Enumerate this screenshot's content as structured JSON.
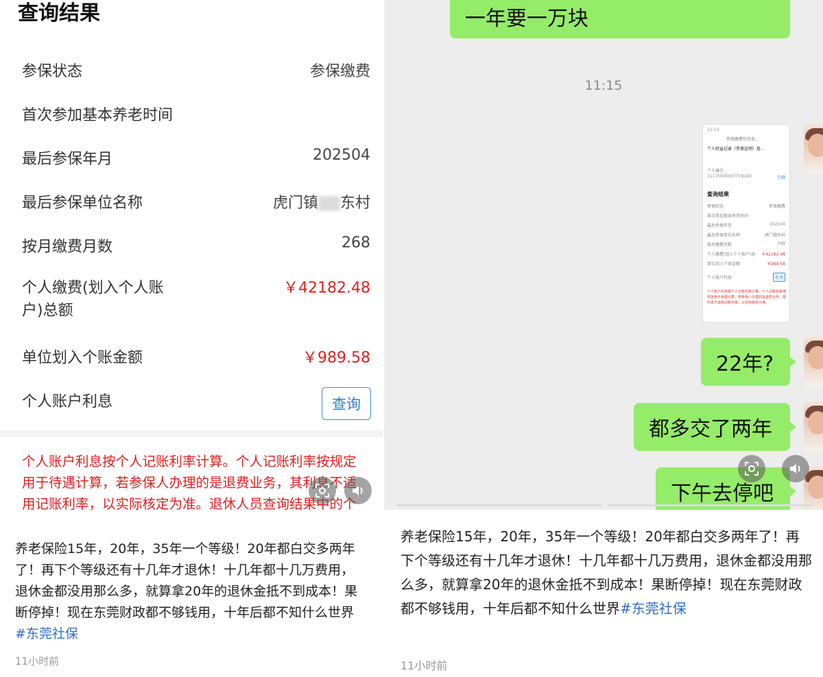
{
  "left": {
    "title": "查询结果",
    "rows": [
      {
        "label": "参保状态",
        "value": "参保缴费"
      },
      {
        "label": "首次参加基本养老时间",
        "value": ""
      },
      {
        "label": "最后参保年月",
        "value": "202504"
      },
      {
        "label": "最后参保单位名称",
        "value_prefix": "虎门镇",
        "value_suffix": "东村"
      },
      {
        "label": "按月缴费月数",
        "value": "268"
      },
      {
        "label_line1": "个人缴费(划入个人账",
        "label_line2": "户)总额",
        "value": "￥42182.48"
      },
      {
        "label": "单位划入个账金额",
        "value": "￥989.58"
      },
      {
        "label": "个人账户利息",
        "button": "查询"
      }
    ],
    "notice": "个人账户利息按个人记账利率计算。个人记账利率按规定用于待遇计算，若参保人办理的是退费业务，其利息不适用记账利率，以实际核定为准。退休人员查询结果中的个人账户利息是本人退休时的个人账户利",
    "caption": "养老保险15年，20年，35年一个等级！20年都白交多两年了！再下个等级还有十几年才退休！十几年都十几万费用，退休金都没用那么多，就算拿20年的退休金抵不到成本！果断停掉！现在东莞财政都不够钱用，十年后都不知什么世界",
    "caption_tag": "#东莞社保",
    "time": "11小时前"
  },
  "right": {
    "messages": [
      {
        "text": "一年要一万块"
      },
      {
        "text": "22年?"
      },
      {
        "text": "都多交了两年"
      },
      {
        "text": "下午去停吧"
      }
    ],
    "timestamp": "11:15",
    "thumbnail": {
      "status_time": "11:13",
      "header": "参保缴费状态查...",
      "record_title": "个人权益记录（参保证明）查...",
      "account_label": "个人编号",
      "account_value": "11170000007779140",
      "account_link": "已绑",
      "section": "查询结果",
      "rows": [
        {
          "label": "参保状态",
          "value": "参保缴费"
        },
        {
          "label": "首次参加基本养老时间",
          "value": ""
        },
        {
          "label": "最后参保年月",
          "value": "202504"
        },
        {
          "label": "最后参保单位名称",
          "value": "虎门镇东村"
        },
        {
          "label": "按月缴费月数",
          "value": "268"
        },
        {
          "label": "个人缴费(划入个人账户)总额",
          "value": "￥42182.48"
        },
        {
          "label": "单位划入个账金额",
          "value": "￥989.58"
        },
        {
          "label": "个人账户利息",
          "value": "查询"
        }
      ],
      "notice": "个人账户利息按个人记账利率计算。个人记账利率按规定用于待遇计算，若参保人办理的是退费业务，其利息不适用记账利率，以实际核定为准。"
    },
    "caption": "养老保险15年，20年，35年一个等级！20年都白交多两年了！再下个等级还有十几年才退休！十几年都十几万费用，退休金都没用那么多，就算拿20年的退休金抵不到成本！果断停掉！现在东莞财政都不够钱用，十年后都不知什么世界",
    "caption_tag": "#东莞社保",
    "time": "11小时前"
  },
  "icons": [
    "scan-text-icon",
    "speaker-icon"
  ],
  "colors": {
    "bubble": "#95ec69",
    "alert": "#e02020",
    "link": "#2f7bd0",
    "chat_bg": "#ededed"
  }
}
